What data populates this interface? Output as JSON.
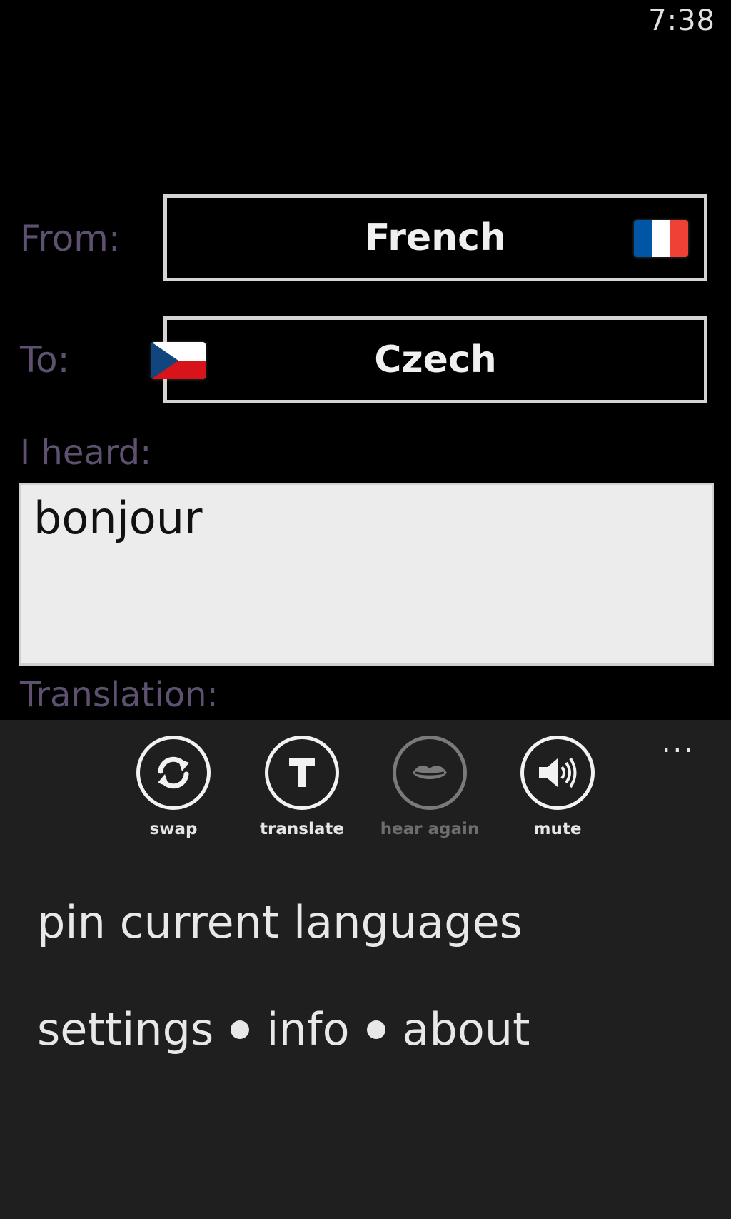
{
  "status_bar": {
    "time": "7:38"
  },
  "from": {
    "label": "From:",
    "language": "French",
    "flag_icon": "flag-france-icon"
  },
  "to": {
    "label": "To:",
    "language": "Czech",
    "flag_icon": "flag-czech-icon"
  },
  "heard": {
    "label": "I heard:",
    "value": "bonjour"
  },
  "translation": {
    "label": "Translation:"
  },
  "app_bar": {
    "more": "...",
    "buttons": [
      {
        "label": "swap",
        "icon": "sync-icon",
        "enabled": true
      },
      {
        "label": "translate",
        "icon": "translate-t-icon",
        "enabled": true
      },
      {
        "label": "hear again",
        "icon": "lips-icon",
        "enabled": false
      },
      {
        "label": "mute",
        "icon": "speaker-icon",
        "enabled": true
      }
    ],
    "menu": {
      "pin": "pin current languages",
      "settings": "settings",
      "info": "info",
      "about": "about"
    }
  },
  "colors": {
    "label_color": "#5e5170",
    "app_bar_bg": "#1f1f1f",
    "flag_france": [
      "#0055a4",
      "#ffffff",
      "#ef4135"
    ],
    "flag_czech": [
      "#ffffff",
      "#d7141a",
      "#11457e"
    ]
  }
}
